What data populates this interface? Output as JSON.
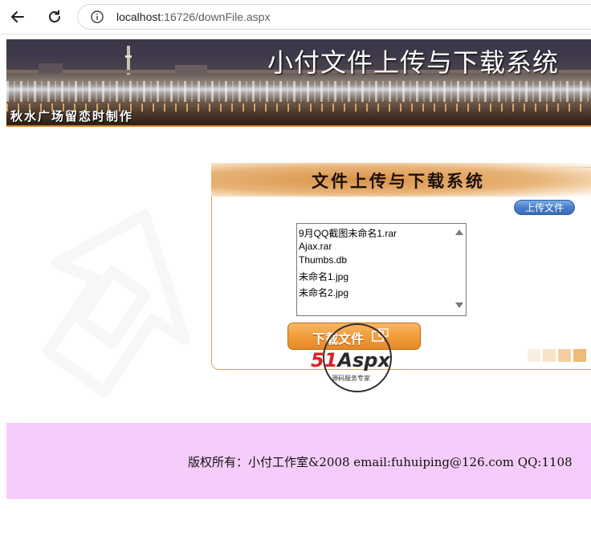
{
  "browser": {
    "url_host": "localhost",
    "url_rest": ":16726/downFile.aspx"
  },
  "banner": {
    "title": "小付文件上传与下载系统",
    "subtitle": "秋水广场留恋时制作"
  },
  "panel": {
    "title": "文件上传与下载系统",
    "upload_label": "上传文件",
    "files": [
      "9月QQ截图未命名1.rar",
      "Ajax.rar",
      "Thumbs.db",
      "未命名1.jpg",
      "未命名2.jpg"
    ],
    "download_label": "下载文件",
    "swatch_colors": [
      "#fbeee0",
      "#f8e2c8",
      "#f4cf9e",
      "#efbb78"
    ]
  },
  "watermark": {
    "brand_51": "51",
    "brand_aspx": "Aspx",
    "tagline": "源码服务专家"
  },
  "footer": {
    "copyright": "版权所有：小付工作室&2008  email:fuhuiping@126.com  QQ:1108"
  },
  "colors": {
    "footer_bg": "#f6cdfa",
    "banner_accent": "#d67a28",
    "panel_border": "#e0a35c",
    "upload_button": "#4a7fc8",
    "download_button": "#f19c3a"
  }
}
